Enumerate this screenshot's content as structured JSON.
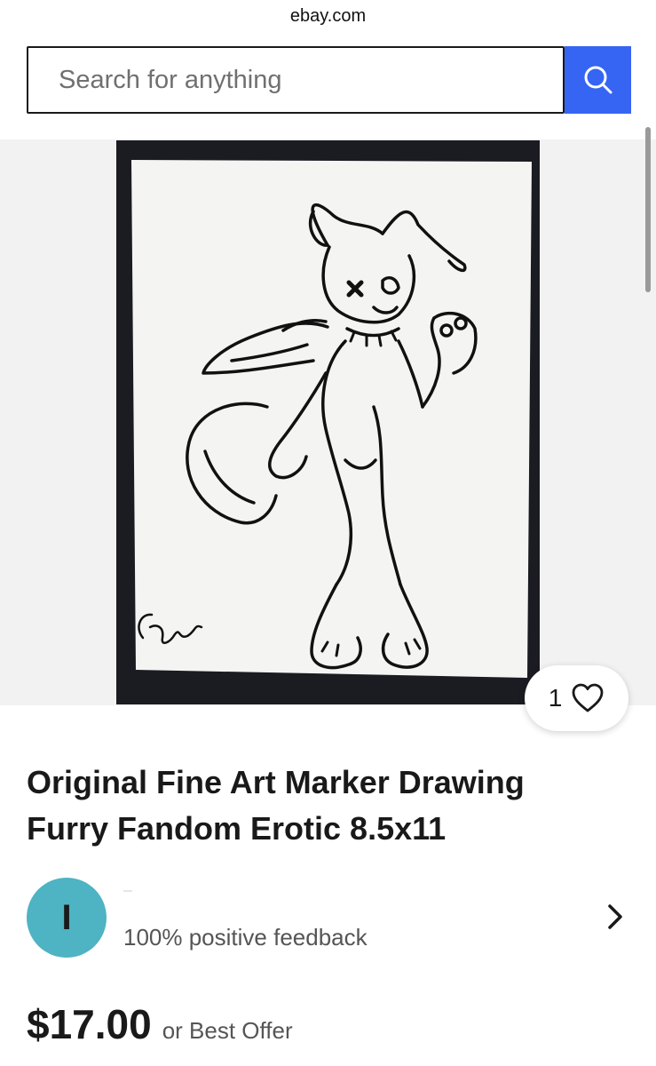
{
  "browser": {
    "url": "ebay.com"
  },
  "search": {
    "placeholder": "Search for anything",
    "button_icon": "search-icon"
  },
  "gallery": {
    "image_desc": "black marker line drawing of a winged canine character on white paper",
    "watch_count": "1",
    "watch_icon": "heart-icon",
    "signature": "Cngast"
  },
  "listing": {
    "title": "Original Fine Art Marker Drawing Furry Fandom Erotic 8.5x11",
    "seller": {
      "avatar_letter": "I",
      "avatar_color": "#4eb3c2",
      "feedback": "100% positive feedback"
    },
    "price": "$17.00",
    "price_suffix": "or Best Offer"
  },
  "colors": {
    "accent": "#3665f3",
    "text": "#191919",
    "muted": "#555555",
    "gallery_bg": "#f2f2f2"
  }
}
